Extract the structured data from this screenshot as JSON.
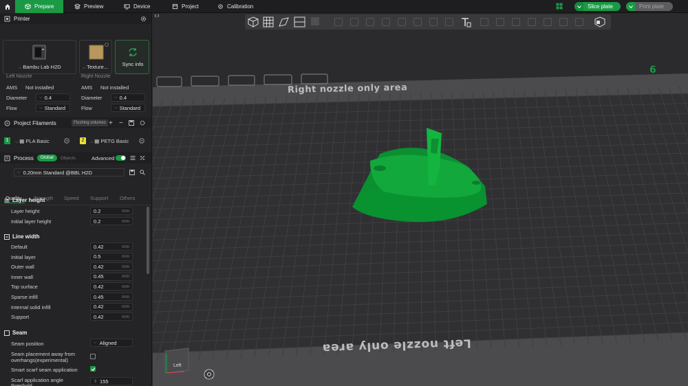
{
  "tabs": [
    {
      "label": "Prepare",
      "icon": "cube-icon",
      "active": true
    },
    {
      "label": "Preview",
      "icon": "layers-icon",
      "active": false
    },
    {
      "label": "Device",
      "icon": "device-icon",
      "active": false
    },
    {
      "label": "Project",
      "icon": "project-icon",
      "active": false
    },
    {
      "label": "Calibration",
      "icon": "calibration-icon",
      "active": false
    }
  ],
  "actions": {
    "slice_label": "Slice plate",
    "print_label": "Print plate"
  },
  "printer": {
    "section_title": "Printer",
    "printer_name": "Bambu Lab H2D",
    "plate_name": "Texture...",
    "sync_label": "Sync info"
  },
  "nozzles": {
    "left": {
      "title": "Left Nozzle",
      "ams_label": "AMS",
      "ams_value": "Not installed",
      "diameter_label": "Diameter",
      "diameter_value": "0.4",
      "flow_label": "Flow",
      "flow_value": "Standard"
    },
    "right": {
      "title": "Right Nozzle",
      "ams_label": "AMS",
      "ams_value": "Not installed",
      "diameter_label": "Diameter",
      "diameter_value": "0.4",
      "flow_label": "Flow",
      "flow_value": "Standard"
    }
  },
  "filaments": {
    "section_title": "Project Filaments",
    "flushing_label": "Flushing volumes",
    "items": [
      {
        "index": "1",
        "name": "PLA Basic",
        "color": "#1a9a45"
      },
      {
        "index": "2",
        "name": "PETG Basic",
        "color": "#e8e03a"
      }
    ]
  },
  "process": {
    "section_title": "Process",
    "scope_global": "Global",
    "scope_objects": "Objects",
    "advanced_label": "Advanced",
    "profile": "0.20mm Standard @BBL H2D",
    "subtabs": [
      "Quality",
      "Strength",
      "Speed",
      "Support",
      "Others"
    ]
  },
  "layer_height": {
    "title": "Layer height",
    "rows": [
      {
        "label": "Layer height",
        "value": "0.2",
        "unit": "mm"
      },
      {
        "label": "Initial layer height",
        "value": "0.2",
        "unit": "mm"
      }
    ]
  },
  "line_width": {
    "title": "Line width",
    "rows": [
      {
        "label": "Default",
        "value": "0.42",
        "unit": "mm"
      },
      {
        "label": "Initial layer",
        "value": "0.5",
        "unit": "mm"
      },
      {
        "label": "Outer wall",
        "value": "0.42",
        "unit": "mm"
      },
      {
        "label": "Inner wall",
        "value": "0.45",
        "unit": "mm"
      },
      {
        "label": "Top surface",
        "value": "0.42",
        "unit": "mm"
      },
      {
        "label": "Sparse infill",
        "value": "0.45",
        "unit": "mm"
      },
      {
        "label": "Internal solid infill",
        "value": "0.42",
        "unit": "mm"
      },
      {
        "label": "Support",
        "value": "0.42",
        "unit": "mm"
      }
    ]
  },
  "seam": {
    "title": "Seam",
    "position_label": "Seam position",
    "position_value": "Aligned",
    "away_label_1": "Seam placement away from",
    "away_label_2": "overhangs(experimental)",
    "smart_label": "Smart scarf seam application",
    "scarf_label_1": "Scarf application angle",
    "scarf_label_2": "threshold",
    "scarf_value": "155"
  },
  "viewport": {
    "top_area_text": "Right nozzle only area",
    "bottom_area_text": "Left nozzle only area",
    "plate_number": "6",
    "view_label": "Left",
    "model_color": "#0fa83a"
  }
}
